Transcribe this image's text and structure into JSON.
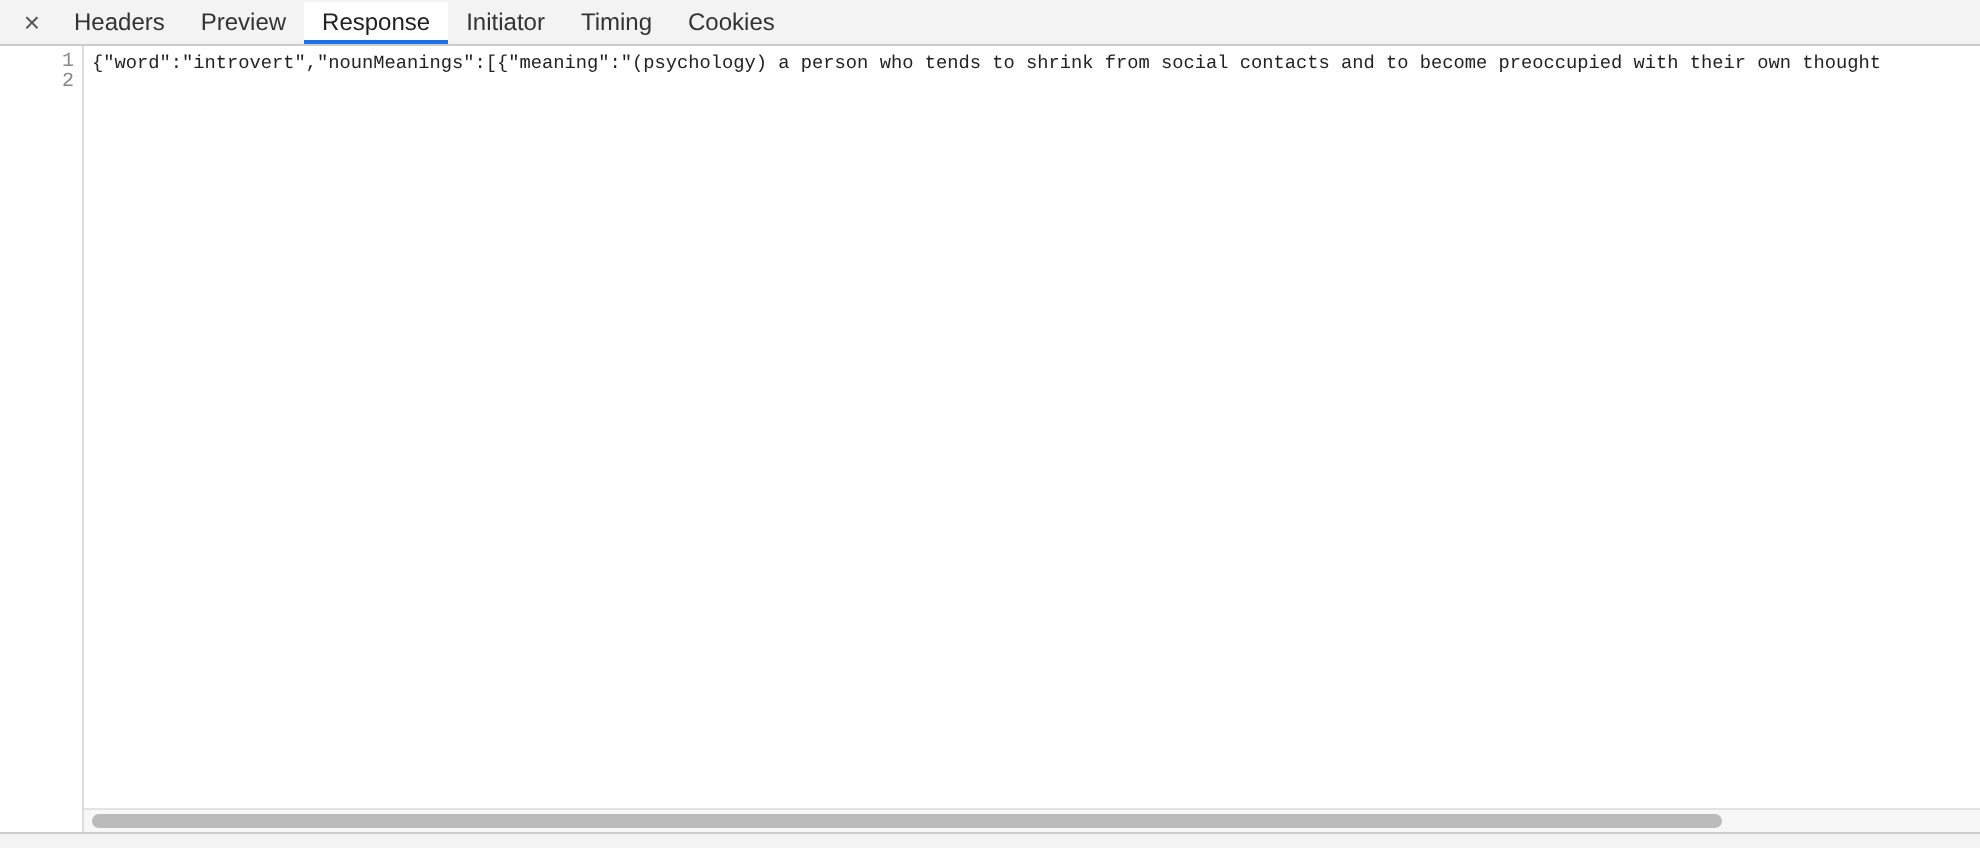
{
  "close_button": "×",
  "tabs": [
    {
      "label": "Headers",
      "selected": false
    },
    {
      "label": "Preview",
      "selected": false
    },
    {
      "label": "Response",
      "selected": true
    },
    {
      "label": "Initiator",
      "selected": false
    },
    {
      "label": "Timing",
      "selected": false
    },
    {
      "label": "Cookies",
      "selected": false
    }
  ],
  "editor": {
    "lines": [
      {
        "number": "1",
        "text": "{\"word\":\"introvert\",\"nounMeanings\":[{\"meaning\":\"(psychology) a person who tends to shrink from social contacts and to become preoccupied with their own thought"
      },
      {
        "number": "2"
      }
    ]
  }
}
